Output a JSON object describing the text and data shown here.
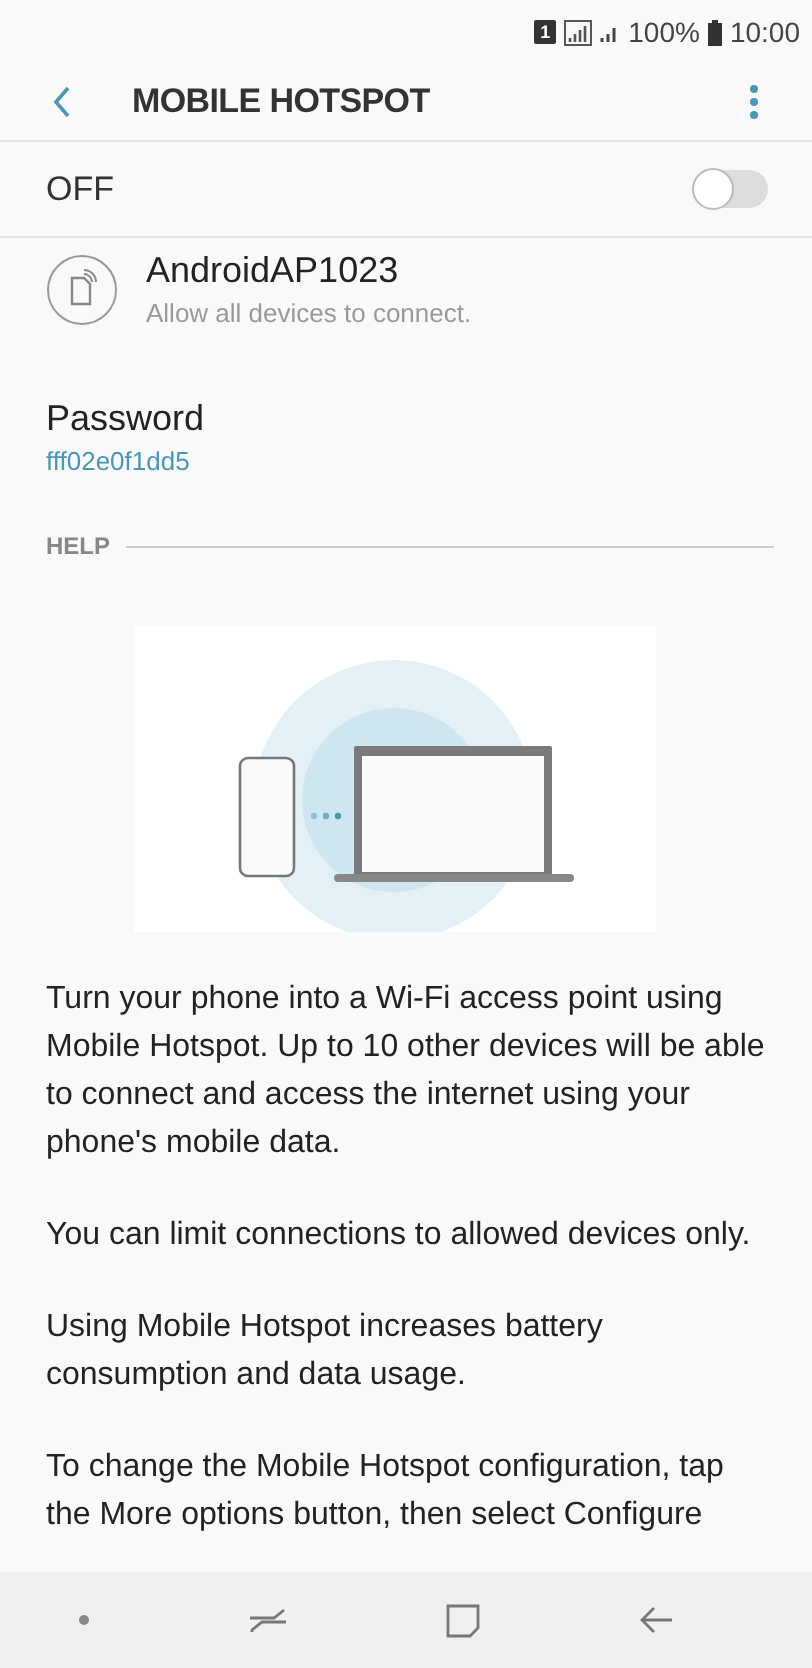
{
  "status_bar": {
    "sim": "1",
    "battery_text": "100%",
    "time": "10:00"
  },
  "app_bar": {
    "title": "MOBILE HOTSPOT"
  },
  "master_switch": {
    "label": "OFF",
    "on": false
  },
  "network": {
    "name": "AndroidAP1023",
    "subtitle": "Allow all devices to connect."
  },
  "password": {
    "label": "Password",
    "value": "fff02e0f1dd5"
  },
  "help": {
    "heading": "HELP",
    "paragraphs": [
      "Turn your phone into a Wi-Fi access point using Mobile Hotspot. Up to 10 other devices will be able to connect and access the internet using your phone's mobile data.",
      "You can limit connections to allowed devices only.",
      "Using Mobile Hotspot increases battery consumption and data usage.",
      "To change the Mobile Hotspot configuration, tap the More options button, then select Configure"
    ]
  }
}
